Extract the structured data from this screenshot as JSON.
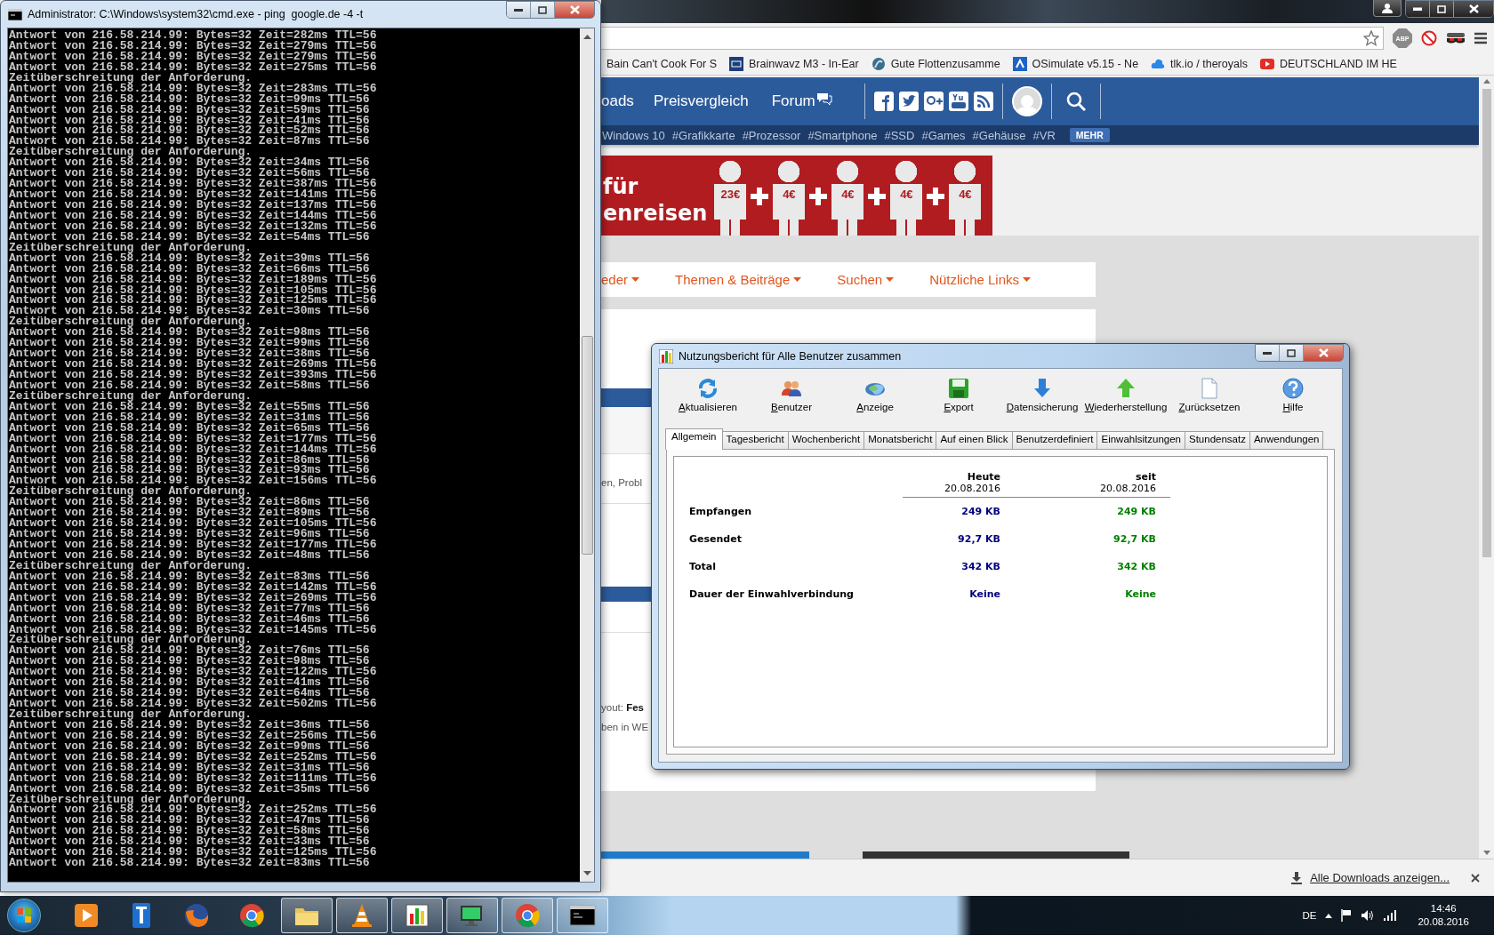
{
  "console": {
    "title": "Administrator: C:\\Windows\\system32\\cmd.exe - ping  google.de -4 -t",
    "lines": [
      "Antwort von 216.58.214.99: Bytes=32 Zeit=282ms TTL=56",
      "Antwort von 216.58.214.99: Bytes=32 Zeit=279ms TTL=56",
      "Antwort von 216.58.214.99: Bytes=32 Zeit=279ms TTL=56",
      "Antwort von 216.58.214.99: Bytes=32 Zeit=275ms TTL=56",
      "Zeitüberschreitung der Anforderung.",
      "Antwort von 216.58.214.99: Bytes=32 Zeit=283ms TTL=56",
      "Antwort von 216.58.214.99: Bytes=32 Zeit=99ms TTL=56",
      "Antwort von 216.58.214.99: Bytes=32 Zeit=59ms TTL=56",
      "Antwort von 216.58.214.99: Bytes=32 Zeit=41ms TTL=56",
      "Antwort von 216.58.214.99: Bytes=32 Zeit=52ms TTL=56",
      "Antwort von 216.58.214.99: Bytes=32 Zeit=87ms TTL=56",
      "Zeitüberschreitung der Anforderung.",
      "Antwort von 216.58.214.99: Bytes=32 Zeit=34ms TTL=56",
      "Antwort von 216.58.214.99: Bytes=32 Zeit=56ms TTL=56",
      "Antwort von 216.58.214.99: Bytes=32 Zeit=387ms TTL=56",
      "Antwort von 216.58.214.99: Bytes=32 Zeit=141ms TTL=56",
      "Antwort von 216.58.214.99: Bytes=32 Zeit=137ms TTL=56",
      "Antwort von 216.58.214.99: Bytes=32 Zeit=144ms TTL=56",
      "Antwort von 216.58.214.99: Bytes=32 Zeit=132ms TTL=56",
      "Antwort von 216.58.214.99: Bytes=32 Zeit=54ms TTL=56",
      "Zeitüberschreitung der Anforderung.",
      "Antwort von 216.58.214.99: Bytes=32 Zeit=39ms TTL=56",
      "Antwort von 216.58.214.99: Bytes=32 Zeit=66ms TTL=56",
      "Antwort von 216.58.214.99: Bytes=32 Zeit=189ms TTL=56",
      "Antwort von 216.58.214.99: Bytes=32 Zeit=105ms TTL=56",
      "Antwort von 216.58.214.99: Bytes=32 Zeit=125ms TTL=56",
      "Antwort von 216.58.214.99: Bytes=32 Zeit=30ms TTL=56",
      "Zeitüberschreitung der Anforderung.",
      "Antwort von 216.58.214.99: Bytes=32 Zeit=98ms TTL=56",
      "Antwort von 216.58.214.99: Bytes=32 Zeit=99ms TTL=56",
      "Antwort von 216.58.214.99: Bytes=32 Zeit=38ms TTL=56",
      "Antwort von 216.58.214.99: Bytes=32 Zeit=269ms TTL=56",
      "Antwort von 216.58.214.99: Bytes=32 Zeit=393ms TTL=56",
      "Antwort von 216.58.214.99: Bytes=32 Zeit=58ms TTL=56",
      "Zeitüberschreitung der Anforderung.",
      "Antwort von 216.58.214.99: Bytes=32 Zeit=55ms TTL=56",
      "Antwort von 216.58.214.99: Bytes=32 Zeit=31ms TTL=56",
      "Antwort von 216.58.214.99: Bytes=32 Zeit=65ms TTL=56",
      "Antwort von 216.58.214.99: Bytes=32 Zeit=177ms TTL=56",
      "Antwort von 216.58.214.99: Bytes=32 Zeit=144ms TTL=56",
      "Antwort von 216.58.214.99: Bytes=32 Zeit=86ms TTL=56",
      "Antwort von 216.58.214.99: Bytes=32 Zeit=93ms TTL=56",
      "Antwort von 216.58.214.99: Bytes=32 Zeit=156ms TTL=56",
      "Zeitüberschreitung der Anforderung.",
      "Antwort von 216.58.214.99: Bytes=32 Zeit=86ms TTL=56",
      "Antwort von 216.58.214.99: Bytes=32 Zeit=89ms TTL=56",
      "Antwort von 216.58.214.99: Bytes=32 Zeit=105ms TTL=56",
      "Antwort von 216.58.214.99: Bytes=32 Zeit=96ms TTL=56",
      "Antwort von 216.58.214.99: Bytes=32 Zeit=177ms TTL=56",
      "Antwort von 216.58.214.99: Bytes=32 Zeit=48ms TTL=56",
      "Zeitüberschreitung der Anforderung.",
      "Antwort von 216.58.214.99: Bytes=32 Zeit=83ms TTL=56",
      "Antwort von 216.58.214.99: Bytes=32 Zeit=142ms TTL=56",
      "Antwort von 216.58.214.99: Bytes=32 Zeit=269ms TTL=56",
      "Antwort von 216.58.214.99: Bytes=32 Zeit=77ms TTL=56",
      "Antwort von 216.58.214.99: Bytes=32 Zeit=46ms TTL=56",
      "Antwort von 216.58.214.99: Bytes=32 Zeit=145ms TTL=56",
      "Zeitüberschreitung der Anforderung.",
      "Antwort von 216.58.214.99: Bytes=32 Zeit=76ms TTL=56",
      "Antwort von 216.58.214.99: Bytes=32 Zeit=98ms TTL=56",
      "Antwort von 216.58.214.99: Bytes=32 Zeit=122ms TTL=56",
      "Antwort von 216.58.214.99: Bytes=32 Zeit=41ms TTL=56",
      "Antwort von 216.58.214.99: Bytes=32 Zeit=64ms TTL=56",
      "Antwort von 216.58.214.99: Bytes=32 Zeit=502ms TTL=56",
      "Zeitüberschreitung der Anforderung.",
      "Antwort von 216.58.214.99: Bytes=32 Zeit=36ms TTL=56",
      "Antwort von 216.58.214.99: Bytes=32 Zeit=256ms TTL=56",
      "Antwort von 216.58.214.99: Bytes=32 Zeit=99ms TTL=56",
      "Antwort von 216.58.214.99: Bytes=32 Zeit=252ms TTL=56",
      "Antwort von 216.58.214.99: Bytes=32 Zeit=31ms TTL=56",
      "Antwort von 216.58.214.99: Bytes=32 Zeit=111ms TTL=56",
      "Antwort von 216.58.214.99: Bytes=32 Zeit=35ms TTL=56",
      "Zeitüberschreitung der Anforderung.",
      "Antwort von 216.58.214.99: Bytes=32 Zeit=252ms TTL=56",
      "Antwort von 216.58.214.99: Bytes=32 Zeit=47ms TTL=56",
      "Antwort von 216.58.214.99: Bytes=32 Zeit=58ms TTL=56",
      "Antwort von 216.58.214.99: Bytes=32 Zeit=33ms TTL=56",
      "Antwort von 216.58.214.99: Bytes=32 Zeit=125ms TTL=56",
      "Antwort von 216.58.214.99: Bytes=32 Zeit=83ms TTL=56"
    ]
  },
  "browser": {
    "extension_label": "ABP",
    "bookmarks": [
      "Bain Can't Cook For S",
      "Brainwavz M3 - In-Ear",
      "Gute Flottenzusamme",
      "OSimulate v5.15 - Ne",
      "tlk.io / theroyals",
      "DEUTSCHLAND IM HE"
    ],
    "nav": [
      "oads",
      "Preisvergleich",
      "Forum"
    ],
    "hashtags": [
      "Windows 10",
      "#Grafikkarte",
      "#Prozessor",
      "#Smartphone",
      "#SSD",
      "#Games",
      "#Gehäuse",
      "#VR"
    ],
    "more": "MEHR",
    "banner": {
      "lines": [
        "für",
        "enreisen"
      ],
      "prices": [
        "23€",
        "4€",
        "4€",
        "4€",
        "4€"
      ]
    },
    "menu": [
      "eder",
      "Themen & Beiträge",
      "Suchen",
      "Nützliche Links"
    ],
    "fragments": [
      "en, Probl",
      "yout: **Fes**",
      "ben in WE"
    ],
    "downloads": "Alle Downloads anzeigen..."
  },
  "dialog": {
    "title": "Nutzungsbericht für Alle Benutzer zusammen",
    "toolbar": [
      "Aktualisieren",
      "Benutzer",
      "Anzeige",
      "Export",
      "Datensicherung",
      "Wiederherstellung",
      "Zurücksetzen",
      "Hilfe"
    ],
    "tabs": [
      {
        "label": "Allgemein",
        "selected": true
      },
      {
        "label": "Tagesbericht",
        "selected": false
      },
      {
        "label": "Wochenbericht",
        "selected": false
      },
      {
        "label": "Monatsbericht",
        "selected": false
      },
      {
        "label": "Auf einen Blick",
        "selected": false
      },
      {
        "label": "Benutzerdefiniert",
        "selected": false
      },
      {
        "label": "Einwahlsitzungen",
        "selected": false
      },
      {
        "label": "Stundensatz",
        "selected": false
      },
      {
        "label": "Anwendungen",
        "selected": false
      }
    ],
    "table": {
      "columns": [
        {
          "title": "Heute",
          "date": "20.08.2016",
          "color": "#000080"
        },
        {
          "title": "seit",
          "date": "20.08.2016",
          "color": "#008000"
        }
      ],
      "rows": [
        {
          "label": "Empfangen",
          "values": [
            "249 KB",
            "249 KB"
          ]
        },
        {
          "label": "Gesendet",
          "values": [
            "92,7 KB",
            "92,7 KB"
          ]
        },
        {
          "label": "Total",
          "values": [
            "342 KB",
            "342 KB"
          ]
        },
        {
          "label": "Dauer der Einwahlverbindung",
          "values": [
            "Keine",
            "Keine"
          ]
        }
      ]
    }
  },
  "taskbar": {
    "apps": [
      {
        "running": false
      },
      {
        "running": false
      },
      {
        "running": false
      },
      {
        "running": false
      },
      {
        "running": true
      },
      {
        "running": true
      },
      {
        "running": true
      },
      {
        "running": true
      },
      {
        "running": true
      },
      {
        "running": true
      }
    ],
    "language": "DE",
    "time": "14:46",
    "date": "20.08.2016"
  }
}
